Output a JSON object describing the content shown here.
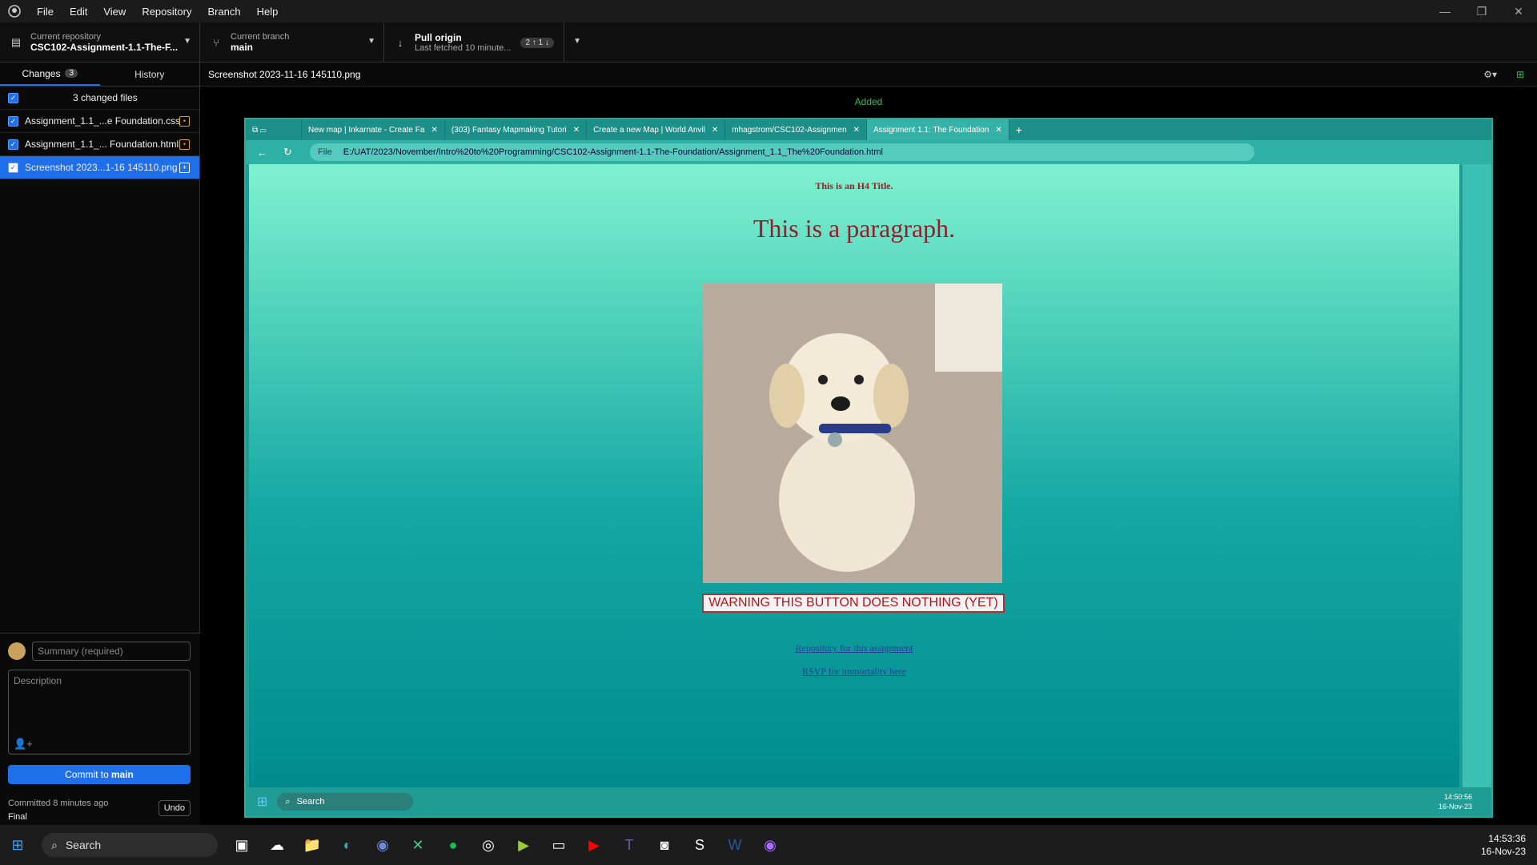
{
  "menu": [
    "File",
    "Edit",
    "View",
    "Repository",
    "Branch",
    "Help"
  ],
  "toolbar": {
    "repo_label": "Current repository",
    "repo_value": "CSC102-Assignment-1.1-The-F...",
    "branch_label": "Current branch",
    "branch_value": "main",
    "pull_label": "Pull origin",
    "pull_sub": "Last fetched 10 minute...",
    "pull_badge": "2 ↑ 1 ↓"
  },
  "sidebar": {
    "tab_changes": "Changes",
    "tab_changes_count": "3",
    "tab_history": "History",
    "changed_files": "3 changed files",
    "files": [
      {
        "name": "Assignment_1.1_...e Foundation.css",
        "status": "modified"
      },
      {
        "name": "Assignment_1.1_... Foundation.html",
        "status": "modified"
      },
      {
        "name": "Screenshot 2023...1-16 145110.png",
        "status": "added"
      }
    ]
  },
  "commit": {
    "summary_placeholder": "Summary (required)",
    "description_placeholder": "Description",
    "button_prefix": "Commit to ",
    "button_branch": "main",
    "last_commit": "Committed 8 minutes ago",
    "last_message": "Final",
    "undo": "Undo"
  },
  "diff": {
    "filename": "Screenshot 2023-11-16 145110.png",
    "status": "Added"
  },
  "browser": {
    "tabs": [
      "New map | Inkarnate - Create Fa",
      "(303) Fantasy Mapmaking Tutori",
      "Create a new Map | World Anvil",
      "mhagstrom/CSC102-Assignmen",
      "Assignment 1.1: The Foundation"
    ],
    "url_prefix": "File",
    "url": "E:/UAT/2023/November/Intro%20to%20Programming/CSC102-Assignment-1.1-The-Foundation/Assignment_1.1_The%20Foundation.html",
    "page": {
      "h4": "This is an H4 Title.",
      "paragraph": "This is a paragraph.",
      "warning_button": "WARNING THIS BUTTON DOES NOTHING (YET)",
      "link1": "Repository for this assignment",
      "link2": "RSVP for immortality here"
    },
    "taskbar_search": "Search",
    "clock_time": "14:50:56",
    "clock_date": "16-Nov-23"
  },
  "taskbar": {
    "search": "Search",
    "time": "14:53:36",
    "date": "16-Nov-23"
  },
  "colors": {
    "accent": "#1f6feb",
    "added": "#3fb950",
    "modified": "#d4a72c"
  }
}
